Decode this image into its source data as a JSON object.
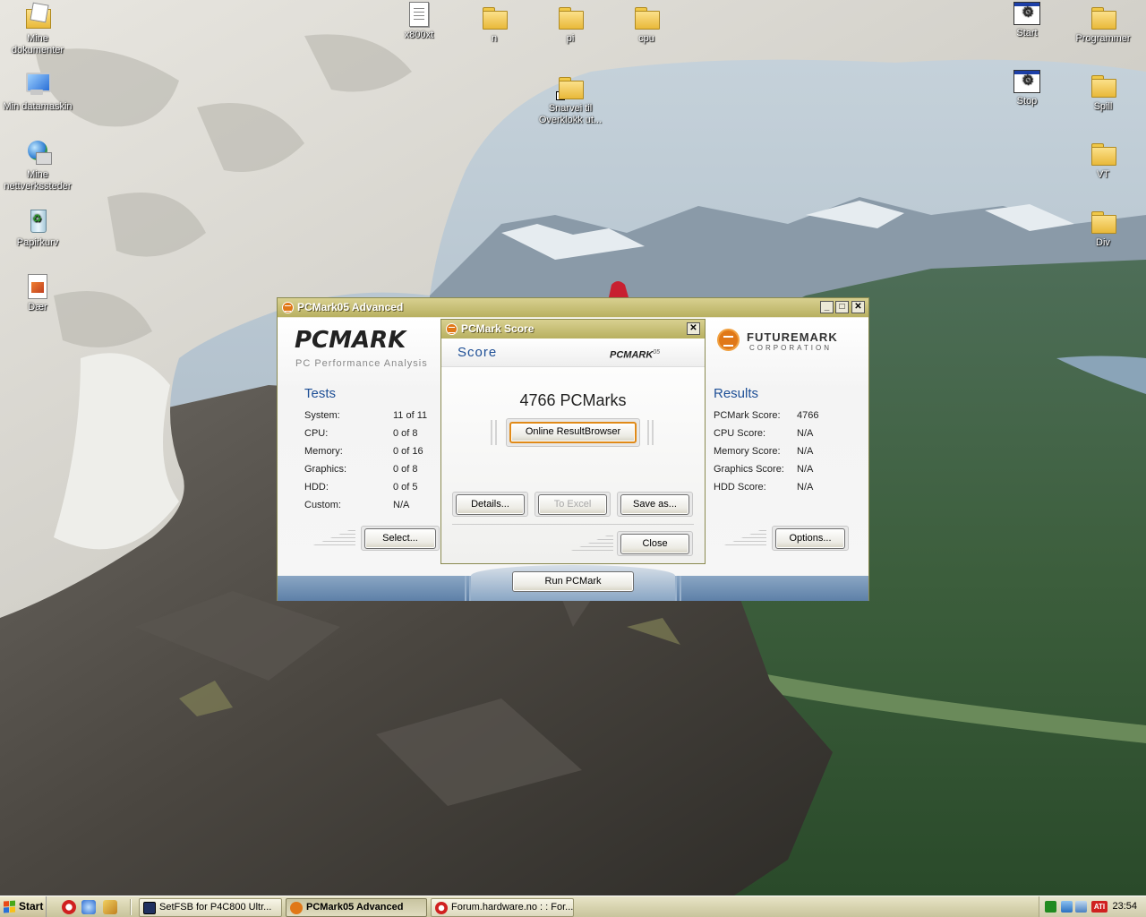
{
  "desktop": {
    "icons": {
      "my_docs": "Mine dokumenter",
      "my_computer": "Min datamaskin",
      "network": "Mine nettverkssteder",
      "recycle": "Papirkurv",
      "daer": "Dær",
      "x800xt": "x800xt",
      "n": "n",
      "pi": "pi",
      "cpu": "cpu",
      "shortcut": "Snarvei til Overklokk ut...",
      "start": "Start",
      "stop": "Stop",
      "programmer": "Programmer",
      "spill": "Spill",
      "vt": "VT",
      "div": "Div"
    }
  },
  "main_window": {
    "title": "PCMark05 Advanced",
    "logo": "PCMARK",
    "logo_sub": "PC Performance Analysis",
    "futuremark": "FUTUREMARK",
    "corporation": "CORPORATION",
    "tests": {
      "heading": "Tests",
      "rows": [
        {
          "label": "System:",
          "value": "11 of 11"
        },
        {
          "label": "CPU:",
          "value": "0 of 8"
        },
        {
          "label": "Memory:",
          "value": "0 of 16"
        },
        {
          "label": "Graphics:",
          "value": "0 of 8"
        },
        {
          "label": "HDD:",
          "value": "0 of 5"
        },
        {
          "label": "Custom:",
          "value": "N/A"
        }
      ],
      "select_button": "Select..."
    },
    "results": {
      "heading": "Results",
      "rows": [
        {
          "label": "PCMark Score:",
          "value": "4766"
        },
        {
          "label": "CPU Score:",
          "value": "N/A"
        },
        {
          "label": "Memory Score:",
          "value": "N/A"
        },
        {
          "label": "Graphics Score:",
          "value": "N/A"
        },
        {
          "label": "HDD Score:",
          "value": "N/A"
        }
      ],
      "options_button": "Options..."
    },
    "run_button": "Run PCMark"
  },
  "score_dialog": {
    "title": "PCMark Score",
    "heading": "Score",
    "logo": "PCMARK",
    "logo_version": "05",
    "score_text": "4766 PCMarks",
    "online_button": "Online ResultBrowser",
    "details_button": "Details...",
    "excel_button": "To Excel",
    "save_button": "Save as...",
    "close_button": "Close"
  },
  "taskbar": {
    "start": "Start",
    "tasks": [
      {
        "label": "SetFSB for P4C800  Ultr..."
      },
      {
        "label": "PCMark05 Advanced"
      },
      {
        "label": "Forum.hardware.no : : For..."
      }
    ],
    "clock": "23:54"
  }
}
